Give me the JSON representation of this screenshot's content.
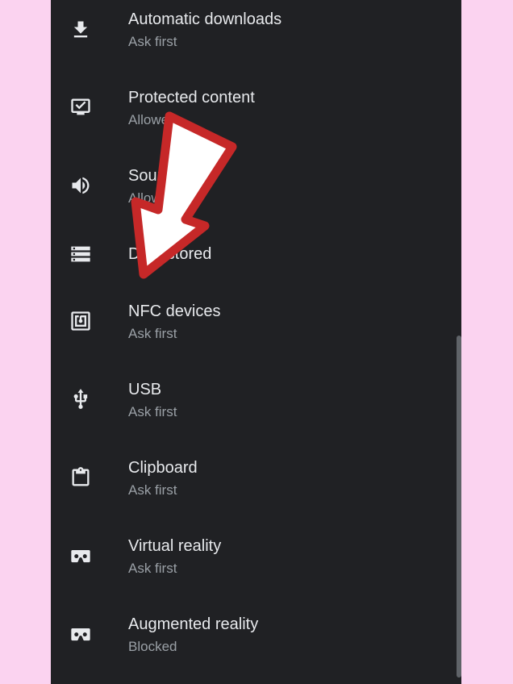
{
  "settings": {
    "items": [
      {
        "title": "Automatic downloads",
        "subtitle": "Ask first",
        "icon": "download-icon"
      },
      {
        "title": "Protected content",
        "subtitle": "Allowed",
        "icon": "protected-content-icon"
      },
      {
        "title": "Sound",
        "subtitle": "Allowed",
        "icon": "volume-icon"
      },
      {
        "title": "Data stored",
        "subtitle": "",
        "icon": "storage-icon"
      },
      {
        "title": "NFC devices",
        "subtitle": "Ask first",
        "icon": "nfc-icon"
      },
      {
        "title": "USB",
        "subtitle": "Ask first",
        "icon": "usb-icon"
      },
      {
        "title": "Clipboard",
        "subtitle": "Ask first",
        "icon": "clipboard-icon"
      },
      {
        "title": "Virtual reality",
        "subtitle": "Ask first",
        "icon": "vr-icon"
      },
      {
        "title": "Augmented reality",
        "subtitle": "Blocked",
        "icon": "ar-icon"
      }
    ]
  },
  "colors": {
    "background": "#fbd3f0",
    "panel": "#202124",
    "title_text": "#e8eaed",
    "subtitle_text": "#9aa0a6",
    "arrow_fill": "#ffffff",
    "arrow_outline": "#c62828"
  }
}
